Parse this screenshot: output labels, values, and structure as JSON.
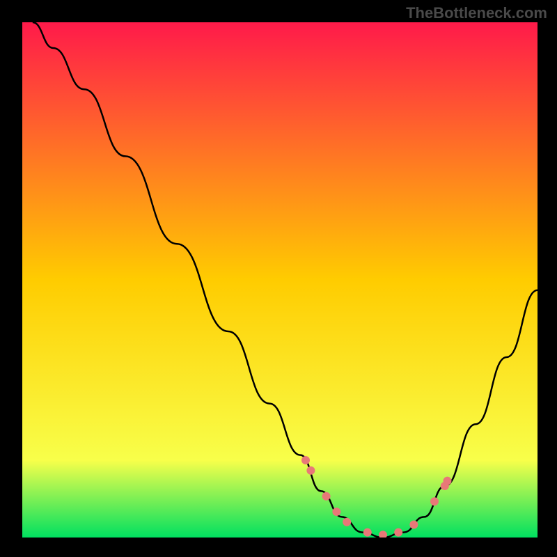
{
  "watermark": "TheBottleneck.com",
  "chart_data": {
    "type": "line",
    "xlabel": "",
    "ylabel": "",
    "xlim": [
      0,
      100
    ],
    "ylim": [
      0,
      100
    ],
    "grid": false,
    "legend": false,
    "background": {
      "type": "vertical_gradient",
      "stops": [
        {
          "pos": 0,
          "color": "#ff1a4a"
        },
        {
          "pos": 50,
          "color": "#ffcc00"
        },
        {
          "pos": 85,
          "color": "#f8ff4a"
        },
        {
          "pos": 100,
          "color": "#00e060"
        }
      ]
    },
    "curve": {
      "color": "#000000",
      "points": [
        {
          "x": 2,
          "y": 100
        },
        {
          "x": 6,
          "y": 95
        },
        {
          "x": 12,
          "y": 87
        },
        {
          "x": 20,
          "y": 74
        },
        {
          "x": 30,
          "y": 57
        },
        {
          "x": 40,
          "y": 40
        },
        {
          "x": 48,
          "y": 26
        },
        {
          "x": 54,
          "y": 16
        },
        {
          "x": 58,
          "y": 9
        },
        {
          "x": 62,
          "y": 4
        },
        {
          "x": 66,
          "y": 1
        },
        {
          "x": 70,
          "y": 0
        },
        {
          "x": 74,
          "y": 1
        },
        {
          "x": 78,
          "y": 4
        },
        {
          "x": 82,
          "y": 10
        },
        {
          "x": 88,
          "y": 22
        },
        {
          "x": 94,
          "y": 35
        },
        {
          "x": 100,
          "y": 48
        }
      ]
    },
    "markers": {
      "color": "#e87878",
      "radius": 6,
      "points": [
        {
          "x": 55,
          "y": 15
        },
        {
          "x": 56,
          "y": 13
        },
        {
          "x": 59,
          "y": 8
        },
        {
          "x": 61,
          "y": 5
        },
        {
          "x": 63,
          "y": 3
        },
        {
          "x": 67,
          "y": 1
        },
        {
          "x": 70,
          "y": 0.5
        },
        {
          "x": 73,
          "y": 1
        },
        {
          "x": 76,
          "y": 2.5
        },
        {
          "x": 80,
          "y": 7
        },
        {
          "x": 82,
          "y": 10
        },
        {
          "x": 82.5,
          "y": 11
        }
      ]
    }
  }
}
